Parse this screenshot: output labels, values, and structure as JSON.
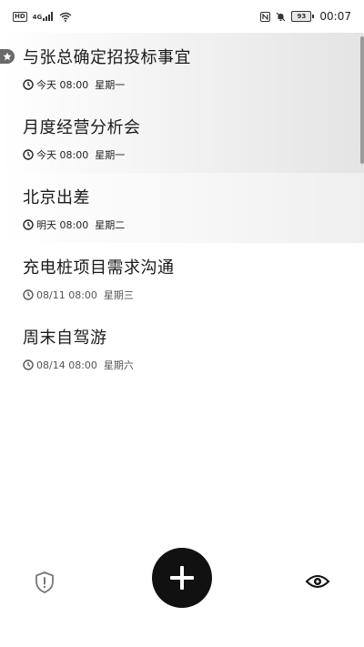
{
  "status_bar": {
    "hd": "HD",
    "signal_text": "4G",
    "battery": "93",
    "time": "00:07"
  },
  "tasks": [
    {
      "title": "与张总确定招投标事宜",
      "date": "今天 08:00",
      "weekday": "星期一",
      "starred": true
    },
    {
      "title": "月度经营分析会",
      "date": "今天 08:00",
      "weekday": "星期一",
      "starred": false
    },
    {
      "title": "北京出差",
      "date": "明天 08:00",
      "weekday": "星期二",
      "starred": false
    },
    {
      "title": "充电桩项目需求沟通",
      "date": "08/11 08:00",
      "weekday": "星期三",
      "starred": false
    },
    {
      "title": "周末自驾游",
      "date": "08/14 08:00",
      "weekday": "星期六",
      "starred": false
    }
  ],
  "bottom_bar": {
    "left_icon": "shield-alert-icon",
    "center_icon": "plus-icon",
    "right_icon": "eye-icon"
  },
  "colors": {
    "fab_background": "#111111",
    "star_badge": "#6a6a6a",
    "highlight_end": "#e4e4e4"
  }
}
